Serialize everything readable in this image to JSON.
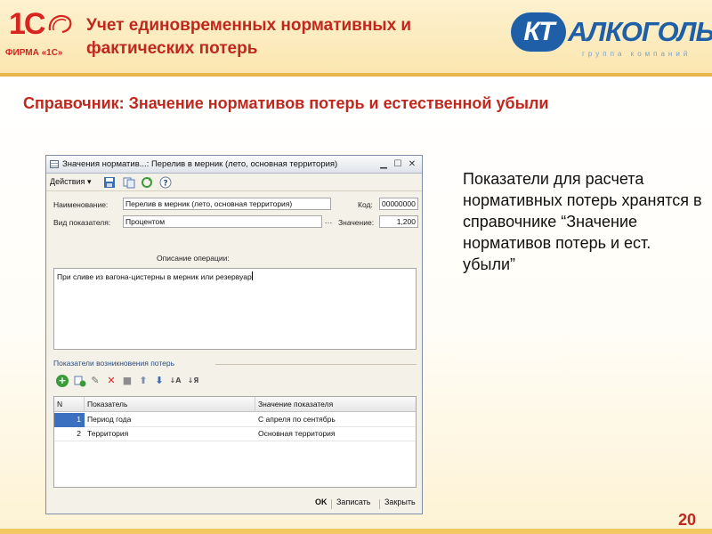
{
  "slide": {
    "header_title": "Учет единовременных нормативных и фактических потерь",
    "page_title": "Справочник: Значение нормативов потерь и естественной убыли",
    "description": "Показатели для расчета нормативных потерь хранятся в справочнике “Значение нормативов потерь и ест. убыли”",
    "slide_number": "20"
  },
  "logo_1c": {
    "main": "1С",
    "caption": "ФИРМА «1С»"
  },
  "logo_kt": {
    "badge": "КТ",
    "word": "АЛКОГОЛЬ",
    "sub": "группа компаний"
  },
  "window": {
    "title": "Значения норматив...: Перелив в мерник (лето, основная территория)",
    "toolbar": {
      "actions_label": "Действия"
    },
    "fields": {
      "name_label": "Наименование:",
      "name_value": "Перелив в мерник (лето, основная территория)",
      "code_label": "Код:",
      "code_value": "00000000",
      "kind_label": "Вид показателя:",
      "kind_value": "Процентом",
      "value_label": "Значение:",
      "value_value": "1,200"
    },
    "description_label": "Описание операции:",
    "description_text": "При сливе из вагона-цистерны в мерник или резервуар",
    "group_title": "Показатели возникновения потерь",
    "table": {
      "columns": [
        "N",
        "Показатель",
        "Значение показателя"
      ],
      "rows": [
        {
          "n": "1",
          "indicator": "Период года",
          "value": "С апреля по сентябрь"
        },
        {
          "n": "2",
          "indicator": "Территория",
          "value": "Основная территория"
        }
      ]
    },
    "footer": {
      "ok": "OK",
      "save": "Записать",
      "close": "Закрыть"
    }
  },
  "colors": {
    "accent_red": "#c0281e",
    "kt_blue": "#1f5fa8",
    "header_bg": "#fbe6b0"
  }
}
